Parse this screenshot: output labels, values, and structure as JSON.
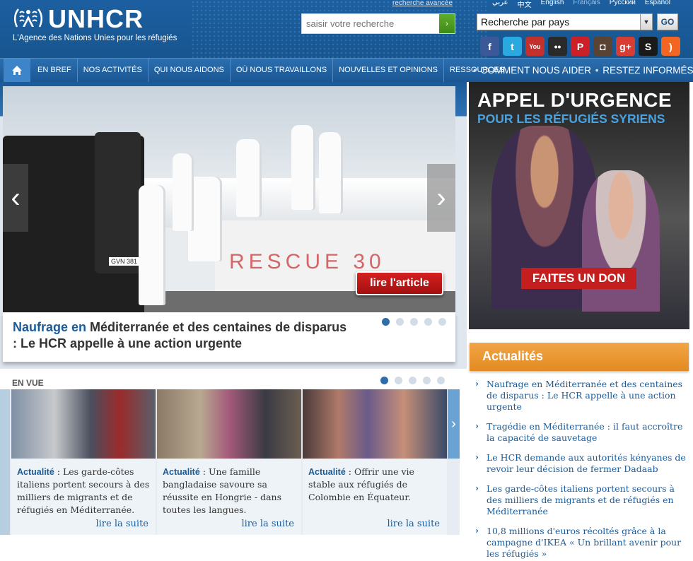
{
  "header": {
    "logo_text": "UNHCR",
    "tagline": "L'Agence des Nations Unies pour les réfugiés",
    "advanced_search": "recherche avancée",
    "search_placeholder": "saisir votre recherche",
    "search_button": "›",
    "languages": [
      "عربي",
      "中文",
      "English",
      "Français",
      "Русский",
      "Español"
    ],
    "country_select": "Recherche par pays",
    "go_label": "GO",
    "social": [
      {
        "name": "facebook-icon",
        "glyph": "f",
        "color": "#3b5998"
      },
      {
        "name": "twitter-icon",
        "glyph": "t",
        "color": "#2aa9e0"
      },
      {
        "name": "youtube-icon",
        "glyph": "You",
        "color": "#c4302b"
      },
      {
        "name": "flickr-icon",
        "glyph": "••",
        "color": "#2a2a2a"
      },
      {
        "name": "pinterest-icon",
        "glyph": "P",
        "color": "#cb2027"
      },
      {
        "name": "instagram-icon",
        "glyph": "◘",
        "color": "#5b4334"
      },
      {
        "name": "googleplus-icon",
        "glyph": "g+",
        "color": "#d73d32"
      },
      {
        "name": "scribd-icon",
        "glyph": "S",
        "color": "#1a1a1a"
      },
      {
        "name": "rss-icon",
        "glyph": ")",
        "color": "#f26522"
      }
    ]
  },
  "nav": {
    "items": [
      "EN BREF",
      "NOS ACTIVITÉS",
      "QUI NOUS AIDONS",
      "OÙ NOUS TRAVAILLONS",
      "NOUVELLES ET OPINIONS",
      "RESSOURCES"
    ],
    "right_1": "COMMENT NOUS AIDER",
    "right_2": "RESTEZ INFORMÉS",
    "separator": "•"
  },
  "hero": {
    "read_button": "lire l'article",
    "caption_highlight": "Naufrage en",
    "caption_rest": "Méditerranée et des centaines de disparus : Le HCR appelle à une action urgente",
    "boat_text": "RESCUE 30",
    "van_plate": "GVN 381",
    "dots_count": 5,
    "active_dot": 0
  },
  "appeal": {
    "title": "APPEL D'URGENCE",
    "subtitle": "POUR LES RÉFUGIÉS SYRIENS",
    "donate": "FAITES UN DON"
  },
  "en_vue": {
    "heading": "EN VUE",
    "cards": [
      {
        "tag": "Actualité",
        "text": " : Les garde-côtes italiens portent secours à des milliers de migrants et de réfugiés en Méditerranée.",
        "more": "lire la suite"
      },
      {
        "tag": "Actualité",
        "text": " : Une famille bangladaise savoure sa réussite en Hongrie - dans toutes les langues.",
        "more": "lire la suite"
      },
      {
        "tag": "Actualité",
        "text": " : Offrir une vie stable aux réfugiés de Colombie en Équateur.",
        "more": "lire la suite"
      }
    ]
  },
  "news": {
    "title": "Actualités",
    "items": [
      "Naufrage en Méditerranée et des centaines de disparus : Le HCR appelle à une action urgente",
      "Tragédie en Méditerranée : il faut accroître la capacité de sauvetage",
      "Le HCR demande aux autorités kényanes de revoir leur décision de fermer Dadaab",
      "Les garde-côtes italiens portent secours à des milliers de migrants et de réfugiés en Méditerranée",
      "10,8 millions d'euros récoltés grâce à la campagne d'IKEA « Un brillant avenir pour les réfugiés »"
    ]
  }
}
